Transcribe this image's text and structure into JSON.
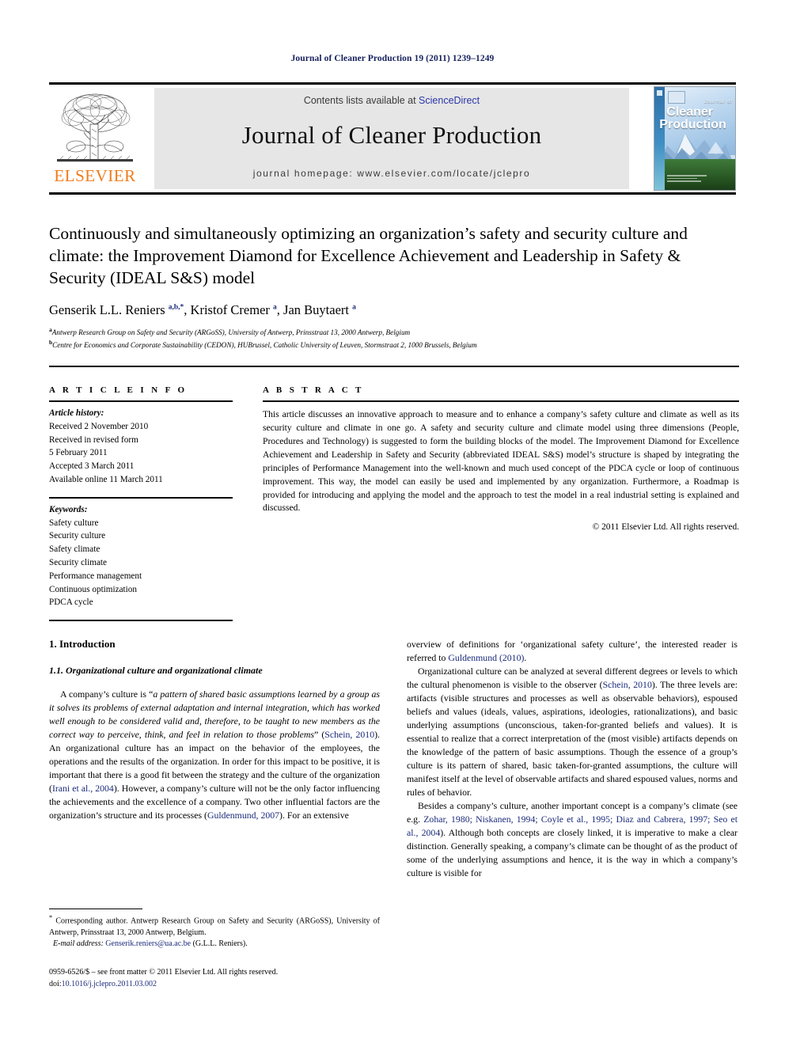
{
  "running_head": "Journal of Cleaner Production 19 (2011) 1239–1249",
  "masthead": {
    "contents_prefix": "Contents lists available at ",
    "sciencedirect": "ScienceDirect",
    "journal_title": "Journal of Cleaner Production",
    "homepage": "journal homepage: www.elsevier.com/locate/jclepro",
    "publisher_wordmark": "ELSEVIER",
    "cover": {
      "kicker": "Journal of",
      "line1": "Cleaner",
      "line2": "Production"
    },
    "accent_link_color": "#2b35a8",
    "publisher_color": "#ef7c1a",
    "box_color": "#e6e6e6"
  },
  "article": {
    "title": "Continuously and simultaneously optimizing an organization’s safety and security culture and climate: the Improvement Diamond for Excellence Achievement and Leadership in Safety & Security (IDEAL S&S) model",
    "authors_html": "Genserik L.L. Reniers <sup>a,b,</sup><sup>*</sup>, Kristof Cremer <sup>a</sup>, Jan Buytaert <sup>a</sup>",
    "affiliations": [
      "Antwerp Research Group on Safety and Security (ARGoSS), University of Antwerp, Prinsstraat 13, 2000 Antwerp, Belgium",
      "Centre for Economics and Corporate Sustainability (CEDON), HUBrussel, Catholic University of Leuven, Stormstraat 2, 1000 Brussels, Belgium"
    ],
    "affiliation_marks": [
      "a",
      "b"
    ]
  },
  "article_info": {
    "heading": "A R T I C L E  I N F O",
    "history_label": "Article history:",
    "history": [
      "Received 2 November 2010",
      "Received in revised form",
      "5 February 2011",
      "Accepted 3 March 2011",
      "Available online 11 March 2011"
    ],
    "keywords_label": "Keywords:",
    "keywords": [
      "Safety culture",
      "Security culture",
      "Safety climate",
      "Security climate",
      "Performance management",
      "Continuous optimization",
      "PDCA cycle"
    ]
  },
  "abstract": {
    "heading": "A B S T R A C T",
    "text": "This article discusses an innovative approach to measure and to enhance a company’s safety culture and climate as well as its security culture and climate in one go. A safety and security culture and climate model using three dimensions (People, Procedures and Technology) is suggested to form the building blocks of the model. The Improvement Diamond for Excellence Achievement and Leadership in Safety and Security (abbreviated IDEAL S&S) model’s structure is shaped by integrating the principles of Performance Management into the well-known and much used concept of the PDCA cycle or loop of continuous improvement. This way, the model can easily be used and implemented by any organization. Furthermore, a Roadmap is provided for introducing and applying the model and the approach to test the model in a real industrial setting is explained and discussed.",
    "copyright": "© 2011 Elsevier Ltd. All rights reserved."
  },
  "body": {
    "section_number_title": "1. Introduction",
    "subsection_number_title": "1.1. Organizational culture and organizational climate",
    "left_paragraph_1_pre": "A company’s culture is “",
    "left_paragraph_1_quote": "a pattern of shared basic assumptions learned by a group as it solves its problems of external adaptation and internal integration, which has worked well enough to be considered valid and, therefore, to be taught to new members as the correct way to perceive, think, and feel in relation to those problems",
    "left_paragraph_1_mid": "” (",
    "left_ref_1": "Schein, 2010",
    "left_paragraph_1_post": "). An organizational culture has an impact on the behavior of the employees, the operations and the results of the organization. In order for this impact to be positive, it is important that there is a good fit between the strategy and the culture of the organization (",
    "left_ref_2": "Irani et al., 2004",
    "left_paragraph_1_post2": "). However, a company’s culture will not be the only factor influencing the achievements and the excellence of a company. Two other influential factors are the organization’s structure and its processes (",
    "left_ref_3": "Guldenmund, 2007",
    "left_paragraph_1_post3": "). For an extensive",
    "right_continuation_pre": "overview of definitions for ‘organizational safety culture’, the interested reader is referred to ",
    "right_ref_1": "Guldenmund (2010)",
    "right_continuation_post": ".",
    "right_paragraph_2_pre": "Organizational culture can be analyzed at several different degrees or levels to which the cultural phenomenon is visible to the observer (",
    "right_ref_2": "Schein, 2010",
    "right_paragraph_2_post": "). The three levels are: artifacts (visible structures and processes as well as observable behaviors), espoused beliefs and values (ideals, values, aspirations, ideologies, rationalizations), and basic underlying assumptions (unconscious, taken-for-granted beliefs and values). It is essential to realize that a correct interpretation of the (most visible) artifacts depends on the knowledge of the pattern of basic assumptions. Though the essence of a group’s culture is its pattern of shared, basic taken-for-granted assumptions, the culture will manifest itself at the level of observable artifacts and shared espoused values, norms and rules of behavior.",
    "right_paragraph_3_pre": "Besides a company’s culture, another important concept is a company’s climate (see e.g. ",
    "right_ref_3": "Zohar, 1980; Niskanen, 1994; Coyle et al., 1995; Diaz and Cabrera, 1997; Seo et al., 2004",
    "right_paragraph_3_post": "). Although both concepts are closely linked, it is imperative to make a clear distinction. Generally speaking, a company’s climate can be thought of as the product of some of the underlying assumptions and hence, it is the way in which a company’s culture is visible for"
  },
  "footnotes": {
    "corresponding_marker": "*",
    "corresponding_text": " Corresponding author. Antwerp Research Group on Safety and Security (ARGoSS), University of Antwerp, Prinsstraat 13, 2000 Antwerp, Belgium.",
    "email_label": "E-mail address:",
    "email": "Genserik.reniers@ua.ac.be",
    "email_owner": "(G.L.L. Reniers).",
    "issn_line": "0959-6526/$ – see front matter © 2011 Elsevier Ltd. All rights reserved.",
    "doi_label": "doi:",
    "doi": "10.1016/j.jclepro.2011.03.002"
  }
}
